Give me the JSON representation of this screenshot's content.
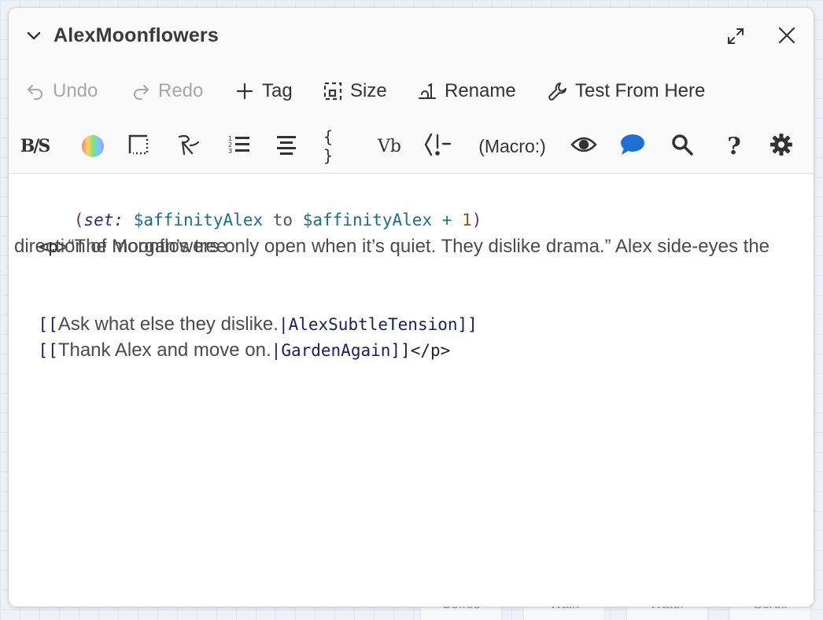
{
  "dialog": {
    "title": "AlexMoonflowers"
  },
  "toolbar_main": {
    "undo": "Undo",
    "redo": "Redo",
    "tag": "Tag",
    "size": "Size",
    "rename": "Rename",
    "test_from_here": "Test From Here"
  },
  "toolbar_format": {
    "macro_label": "(Macro:)",
    "vb_label": "Vb",
    "code_label": "{ }",
    "question_label": "?",
    "bs_label": "B/S"
  },
  "editor": {
    "line1": {
      "open_paren": "(",
      "macro": "set:",
      "var1": "$affinityAlex",
      "kw": "to",
      "var2": "$affinityAlex",
      "op": "+",
      "num": "1",
      "close_paren": ")"
    },
    "line2": {
      "tag_open": "<p>",
      "text": "“The moonflowers only open when it’s quiet. They dislike drama.” Alex side-eyes the"
    },
    "line3": "direction of Morgan’s tree.",
    "link1": {
      "open": "[[",
      "text": "Ask what else they dislike.",
      "sep": "|",
      "target": "AlexSubtleTension",
      "close": "]]"
    },
    "link2": {
      "open": "[[",
      "text": "Thank Alex and move on.",
      "sep": "|",
      "target": "GardenAgain",
      "close": "]]",
      "tag_close": "</p>"
    }
  },
  "background_cards": [
    "Coffee",
    "Walk",
    "Water",
    "Scroll"
  ],
  "colors": {
    "accent_blue": "#1f6fd6",
    "disabled": "#a7a7a7"
  }
}
